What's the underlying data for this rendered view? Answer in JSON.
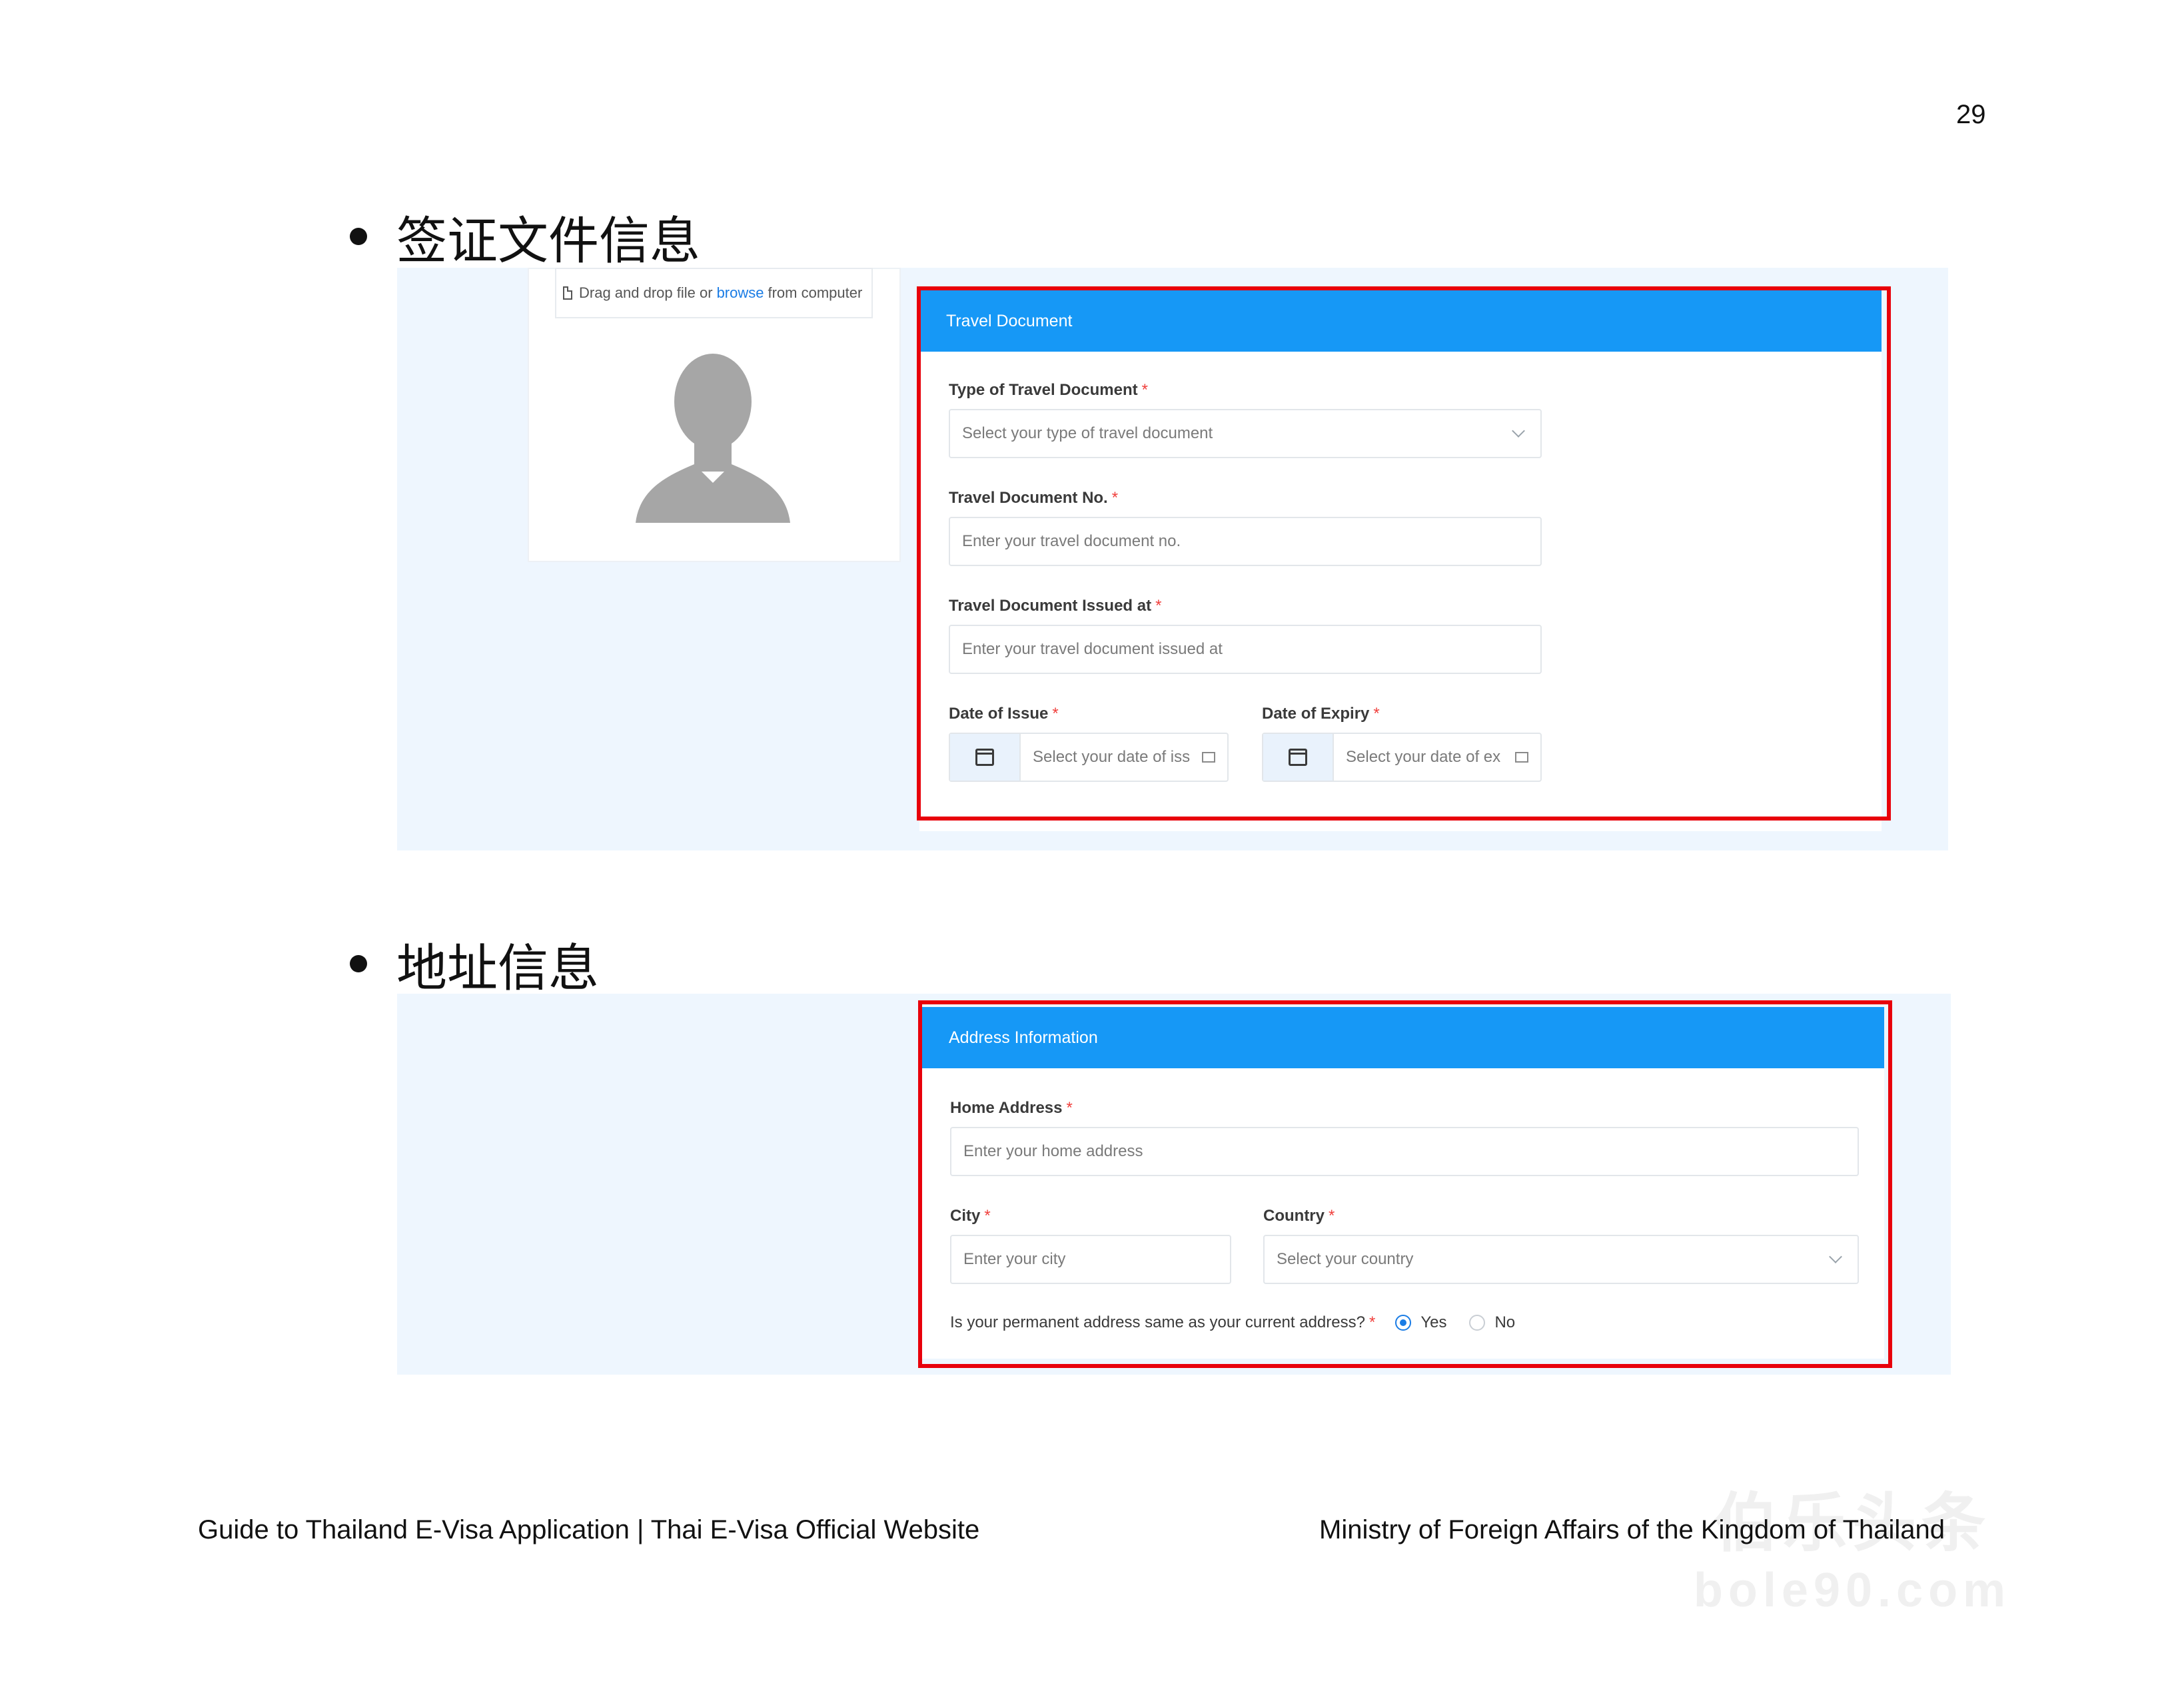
{
  "page": {
    "number": "29"
  },
  "sections": {
    "travel": {
      "heading": "签证文件信息"
    },
    "address": {
      "heading": "地址信息"
    }
  },
  "upload": {
    "text_before": "Drag and drop file or",
    "link": "browse",
    "text_after": "from computer"
  },
  "travel_document": {
    "title": "Travel Document",
    "type_label": "Type of Travel Document",
    "type_placeholder": "Select your type of travel document",
    "no_label": "Travel Document No.",
    "no_placeholder": "Enter your travel document no.",
    "issued_label": "Travel Document Issued at",
    "issued_placeholder": "Enter your travel document issued at",
    "issue_date_label": "Date of Issue",
    "issue_date_placeholder": "Select your date of iss",
    "expiry_date_label": "Date of Expiry",
    "expiry_date_placeholder": "Select your date of ex",
    "required_mark": "*"
  },
  "address_information": {
    "title": "Address Information",
    "home_label": "Home Address",
    "home_placeholder": "Enter your home address",
    "city_label": "City",
    "city_placeholder": "Enter your city",
    "country_label": "Country",
    "country_placeholder": "Select your country",
    "same_question": "Is your permanent address same as your current address?",
    "yes": "Yes",
    "no": "No",
    "required_mark": "*"
  },
  "footer": {
    "left": "Guide to Thailand E-Visa Application | Thai E-Visa Official Website",
    "right": "Ministry of Foreign Affairs of the Kingdom of Thailand"
  },
  "watermark": {
    "line1": "伯乐头条",
    "line2": "bole90.com"
  },
  "colors": {
    "header_blue": "#1698f6",
    "highlight_red": "#e8000b",
    "panel_bg": "#eef6fe",
    "link_blue": "#1a7ce5"
  }
}
